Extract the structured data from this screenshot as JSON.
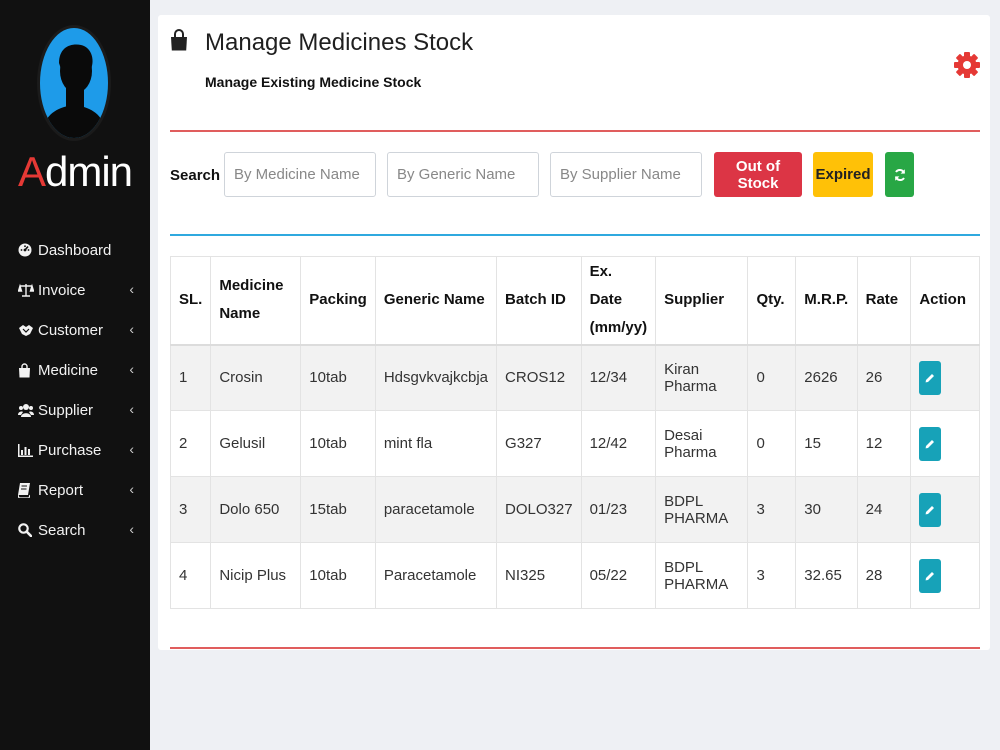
{
  "sidebar": {
    "brand_first": "A",
    "brand_rest": "dmin",
    "items": [
      {
        "label": "Dashboard",
        "icon": "dashboard-icon",
        "has_submenu": false
      },
      {
        "label": "Invoice",
        "icon": "balance-scale-icon",
        "has_submenu": true
      },
      {
        "label": "Customer",
        "icon": "handshake-icon",
        "has_submenu": true
      },
      {
        "label": "Medicine",
        "icon": "shopping-bag-icon",
        "has_submenu": true
      },
      {
        "label": "Supplier",
        "icon": "users-icon",
        "has_submenu": true
      },
      {
        "label": "Purchase",
        "icon": "bar-chart-icon",
        "has_submenu": true
      },
      {
        "label": "Report",
        "icon": "book-icon",
        "has_submenu": true
      },
      {
        "label": "Search",
        "icon": "search-icon",
        "has_submenu": true
      }
    ],
    "chevron": "‹"
  },
  "header": {
    "title": "Manage Medicines Stock",
    "subtitle": "Manage Existing Medicine Stock"
  },
  "search": {
    "label": "Search :",
    "medicine_placeholder": "By Medicine Name",
    "generic_placeholder": "By Generic Name",
    "supplier_placeholder": "By Supplier Name",
    "out_of_stock_label": "Out of Stock",
    "expired_label": "Expired"
  },
  "table": {
    "headers": [
      "SL.",
      "Medicine Name",
      "Packing",
      "Generic Name",
      "Batch ID",
      "Ex. Date (mm/yy)",
      "Supplier",
      "Qty.",
      "M.R.P.",
      "Rate",
      "Action"
    ],
    "rows": [
      [
        "1",
        "Crosin",
        "10tab",
        "Hdsgvkvajkcbja",
        "CROS12",
        "12/34",
        "Kiran Pharma",
        "0",
        "2626",
        "26"
      ],
      [
        "2",
        "Gelusil",
        "10tab",
        "mint fla",
        "G327",
        "12/42",
        "Desai Pharma",
        "0",
        "15",
        "12"
      ],
      [
        "3",
        "Dolo 650",
        "15tab",
        "paracetamole",
        "DOLO327",
        "01/23",
        "BDPL PHARMA",
        "3",
        "30",
        "24"
      ],
      [
        "4",
        "Nicip Plus",
        "10tab",
        "Paracetamole",
        "NI325",
        "05/22",
        "BDPL PHARMA",
        "3",
        "32.65",
        "28"
      ]
    ]
  },
  "colors": {
    "sidebar_bg": "#111111",
    "accent_red": "#dc3545",
    "accent_yellow": "#ffc107",
    "accent_green": "#28a745",
    "edit_blue": "#17a2b8",
    "divider_red": "#e05d5d",
    "divider_blue": "#2fa9df",
    "gear": "#e53935"
  }
}
